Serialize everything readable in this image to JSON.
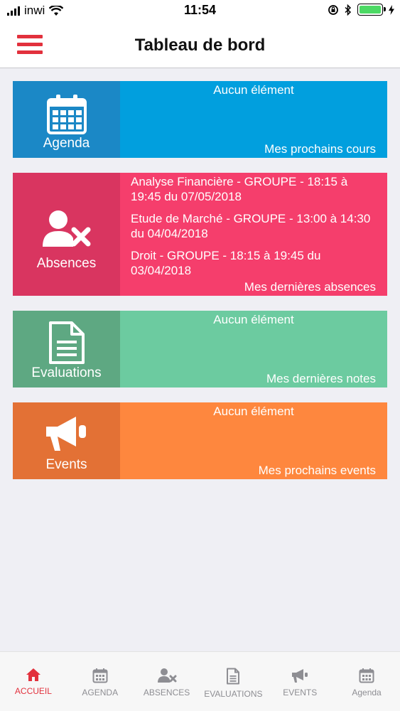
{
  "status_bar": {
    "carrier": "inwi",
    "time": "11:54"
  },
  "header": {
    "title": "Tableau de bord"
  },
  "cards": [
    {
      "id": "agenda",
      "label": "Agenda",
      "icon": "calendar-icon",
      "empty_text": "Aucun élément",
      "footer": "Mes prochains cours",
      "color": "#019fde",
      "icon_bg": "#1b88c6"
    },
    {
      "id": "absences",
      "label": "Absences",
      "icon": "user-x-icon",
      "items": [
        "Analyse Financière - GROUPE - 18:15 à 19:45 du 07/05/2018",
        "Etude de Marché - GROUPE - 13:00 à 14:30 du 04/04/2018",
        "Droit - GROUPE - 18:15 à 19:45 du 03/04/2018"
      ],
      "footer": "Mes dernières absences",
      "color": "#f53e6c",
      "icon_bg": "#d93560"
    },
    {
      "id": "evaluations",
      "label": "Evaluations",
      "icon": "document-icon",
      "empty_text": "Aucun élément",
      "footer": "Mes dernières notes",
      "color": "#6ccba0",
      "icon_bg": "#5ea882"
    },
    {
      "id": "events",
      "label": "Events",
      "icon": "megaphone-icon",
      "empty_text": "Aucun élément",
      "footer": "Mes prochains events",
      "color": "#fe873e",
      "icon_bg": "#e37135"
    }
  ],
  "tabs": [
    {
      "label": "ACCUEIL",
      "icon": "home-icon",
      "active": true
    },
    {
      "label": "AGENDA",
      "icon": "calendar-icon",
      "active": false
    },
    {
      "label": "ABSENCES",
      "icon": "user-x-icon",
      "active": false
    },
    {
      "label": "EVALUATIONS",
      "icon": "document-icon",
      "active": false
    },
    {
      "label": "EVENTS",
      "icon": "megaphone-icon",
      "active": false
    },
    {
      "label": "Agenda",
      "icon": "calendar-icon",
      "active": false
    }
  ],
  "accent_color": "#e2313d"
}
